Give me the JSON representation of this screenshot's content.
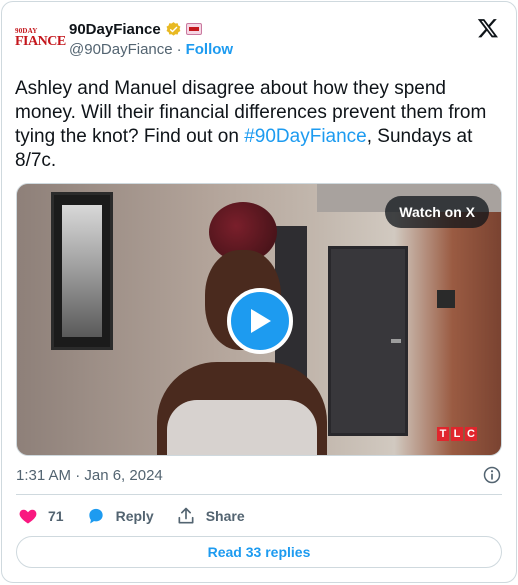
{
  "author": {
    "logo_line1": "90",
    "logo_line2": "DAY",
    "logo_line3": "FIANCE",
    "display_name": "90DayFiance",
    "handle": "@90DayFiance",
    "separator": "·",
    "follow_label": "Follow",
    "verified_color": "#e8b923"
  },
  "tweet": {
    "text_before": "Ashley and Manuel disagree about how they spend money. Will their financial differences prevent them from tying the knot? Find out on ",
    "hashtag": "#90DayFiance",
    "text_after": ", Sundays at 8/7c."
  },
  "media": {
    "watch_label": "Watch on X",
    "watermark": [
      "T",
      "L",
      "C"
    ]
  },
  "timestamp": "1:31 AM · Jan 6, 2024",
  "actions": {
    "likes": "71",
    "reply_label": "Reply",
    "share_label": "Share"
  },
  "read_replies_label": "Read 33 replies",
  "colors": {
    "accent": "#1d9bf0",
    "like": "#f91880",
    "muted": "#536471"
  }
}
